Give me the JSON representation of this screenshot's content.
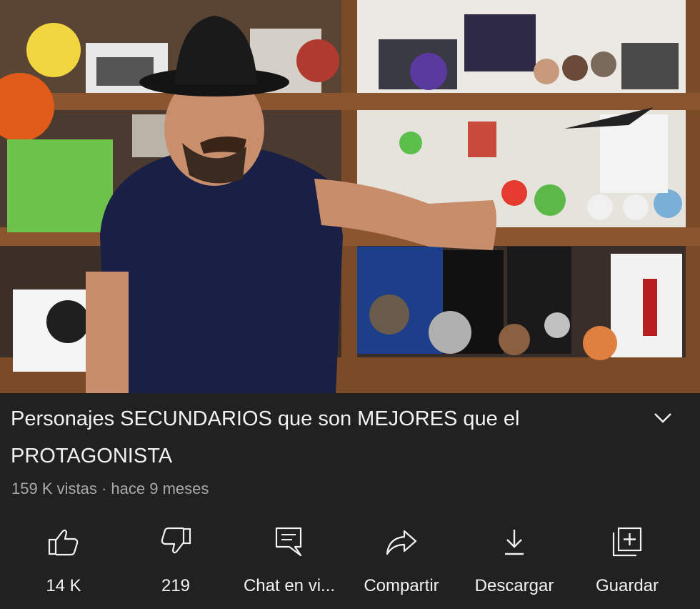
{
  "video": {
    "scene": "presenter-with-collectibles-shelf"
  },
  "title": "Personajes SECUNDARIOS que son MEJORES que el PROTAGONISTA",
  "meta": {
    "views": "159 K vistas",
    "separator": "·",
    "age": "hace 9 meses"
  },
  "actions": [
    {
      "icon": "thumbs-up-icon",
      "label": "14 K"
    },
    {
      "icon": "thumbs-down-icon",
      "label": "219"
    },
    {
      "icon": "live-chat-icon",
      "label": "Chat en vi..."
    },
    {
      "icon": "share-icon",
      "label": "Compartir"
    },
    {
      "icon": "download-icon",
      "label": "Descargar"
    },
    {
      "icon": "save-icon",
      "label": "Guardar"
    }
  ],
  "colors": {
    "background": "#212121",
    "text_primary": "#f1f1f1",
    "text_secondary": "#aaaaaa"
  }
}
